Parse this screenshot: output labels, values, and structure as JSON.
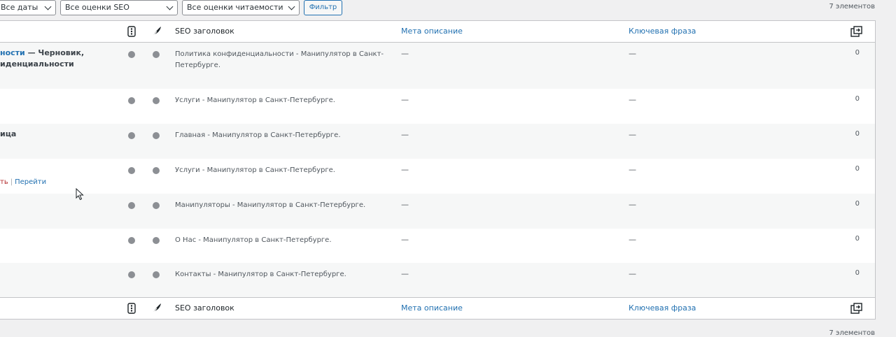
{
  "filters": {
    "date": "Все даты",
    "seo": "Все оценки SEO",
    "readability": "Все оценки читаемости",
    "button": "Фильтр"
  },
  "count_top": "7 элементов",
  "count_bottom": "7 элементов",
  "columns": {
    "seo_icon": "seo-score-icon",
    "readability_icon": "readability-feather-icon",
    "seo_title": "SEO заголовок",
    "meta": "Мета описание",
    "keyphrase": "Ключевая фраза",
    "links_icon": "outgoing-links-icon"
  },
  "rows": [
    {
      "title_link": "ности",
      "title_rest": " — Черновик,",
      "title_line2": "иденциальности",
      "seo_title": "Политика конфиденциальности - Манипулятор в Санкт-Петербурге.",
      "meta": "—",
      "keyphrase": "—",
      "links": "0"
    },
    {
      "seo_title": "Услуги - Манипулятор в Санкт-Петербурге.",
      "meta": "—",
      "keyphrase": "—",
      "links": "0"
    },
    {
      "title_plain": "ица",
      "seo_title": "Главная - Манипулятор в Санкт-Петербурге.",
      "meta": "—",
      "keyphrase": "—",
      "links": "0"
    },
    {
      "action_delete": "ть",
      "action_sep": "|",
      "action_view": "Перейти",
      "seo_title": "Услуги - Манипулятор в Санкт-Петербурге.",
      "meta": "—",
      "keyphrase": "—",
      "links": "0"
    },
    {
      "seo_title": "Манипуляторы - Манипулятор в Санкт-Петербурге.",
      "meta": "—",
      "keyphrase": "—",
      "links": "0"
    },
    {
      "seo_title": "О Нас - Манипулятор в Санкт-Петербурге.",
      "meta": "—",
      "keyphrase": "—",
      "links": "0"
    },
    {
      "seo_title": "Контакты - Манипулятор в Санкт-Петербурге.",
      "meta": "—",
      "keyphrase": "—",
      "links": "0"
    }
  ],
  "colors": {
    "link": "#2271b1",
    "dot": "#8c8f94",
    "delete": "#b32d2e"
  }
}
